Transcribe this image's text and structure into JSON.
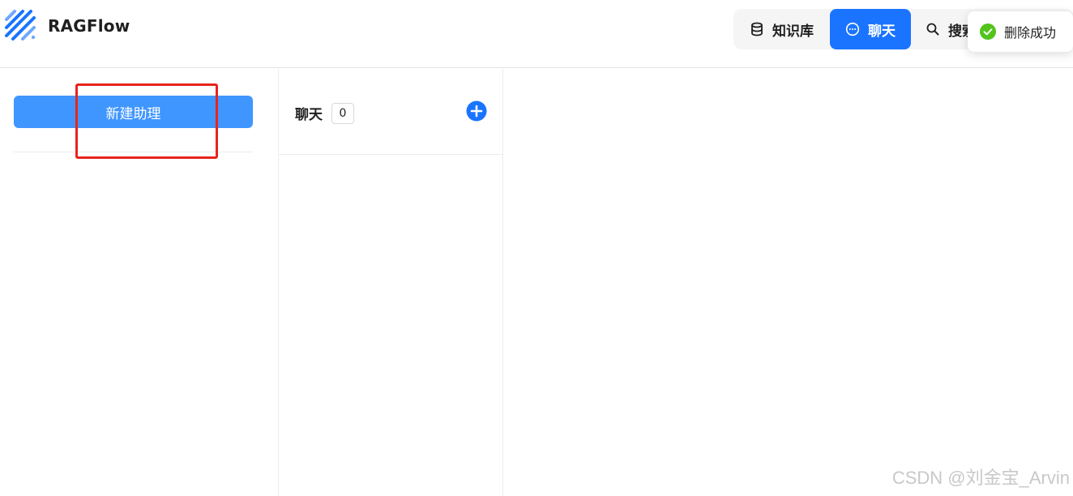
{
  "app": {
    "name": "RAGFlow"
  },
  "nav": {
    "tabs": [
      {
        "label": "知识库",
        "icon": "database-icon",
        "active": false
      },
      {
        "label": "聊天",
        "icon": "chat-bubble-icon",
        "active": true
      },
      {
        "label": "搜索",
        "icon": "search-icon",
        "active": false
      }
    ],
    "accent": "#1a74ff"
  },
  "toast": {
    "message": "删除成功",
    "icon": "check-circle-icon",
    "color": "#52c41a"
  },
  "sidebar": {
    "new_assistant_label": "新建助理",
    "button_color": "#4096ff"
  },
  "chat_list": {
    "title": "聊天",
    "count": "0",
    "add_icon": "plus-circle-icon"
  },
  "annotation": {
    "color": "#e8241c"
  },
  "watermark": {
    "text": "CSDN @刘金宝_Arvin"
  }
}
